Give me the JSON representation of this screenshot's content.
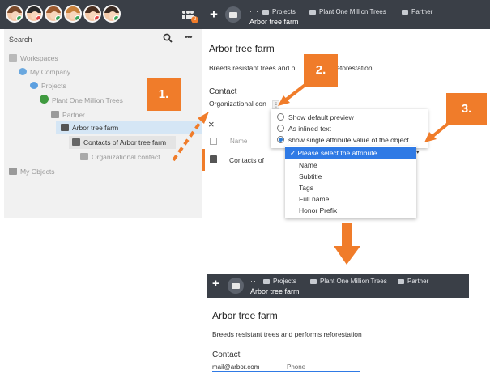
{
  "header": {
    "breadcrumb_dots": "···",
    "breadcrumbs": [
      "Projects",
      "Plant One Million Trees",
      "Partner"
    ],
    "current_title": "Arbor tree farm",
    "team_badge": "2",
    "plus_glyph": "+"
  },
  "avatars": [
    {
      "hair": "#7a4a2a",
      "badge": "#3aa55a"
    },
    {
      "hair": "#2a2a2a",
      "badge": "#e04545"
    },
    {
      "hair": "#9c5a2e",
      "badge": "#3aa55a"
    },
    {
      "hair": "#c7803a",
      "badge": "#3aa55a"
    },
    {
      "hair": "#4a2f20",
      "badge": "#e04545"
    },
    {
      "hair": "#3a2a22",
      "badge": "#3aa55a"
    }
  ],
  "sidebar": {
    "search_label": "Search",
    "more_glyph": "•••",
    "tree": [
      "Workspaces",
      "My Company",
      "Projects",
      "Plant One Million Trees",
      "Partner",
      "Arbor tree farm",
      "Contacts of Arbor tree farm",
      "Organizational contact",
      "My Objects"
    ]
  },
  "main": {
    "title": "Arbor tree farm",
    "description_start": "Breeds resistant trees and p",
    "description_end": "reforestation",
    "contact_heading": "Contact",
    "org_label": "Organizational con",
    "kebab_glyph": "⋮",
    "close_glyph": "×",
    "name_column": "Name",
    "row_label": "Contacts of"
  },
  "popup": {
    "options": [
      "Show default preview",
      "As inlined text",
      "show single attribute value of the object"
    ],
    "selected_index": 2
  },
  "dropdown": {
    "placeholder": "✓ Please select the attribute",
    "options": [
      "Name",
      "Subtitle",
      "Tags",
      "Full name",
      "Honor Prefix"
    ],
    "caret": "▾"
  },
  "callouts": [
    "1.",
    "2.",
    "3."
  ],
  "result": {
    "breadcrumbs": [
      "Projects",
      "Plant One Million Trees",
      "Partner"
    ],
    "title_bar": "Arbor tree farm",
    "title": "Arbor tree farm",
    "description": "Breeds resistant trees and performs reforestation",
    "contact_heading": "Contact",
    "email": "mail@arbor.com",
    "phone_label": "Phone"
  },
  "colors": {
    "accent_orange": "#f07c2a",
    "topbar": "#3a3f47",
    "selection_blue": "#2f7ae5"
  }
}
